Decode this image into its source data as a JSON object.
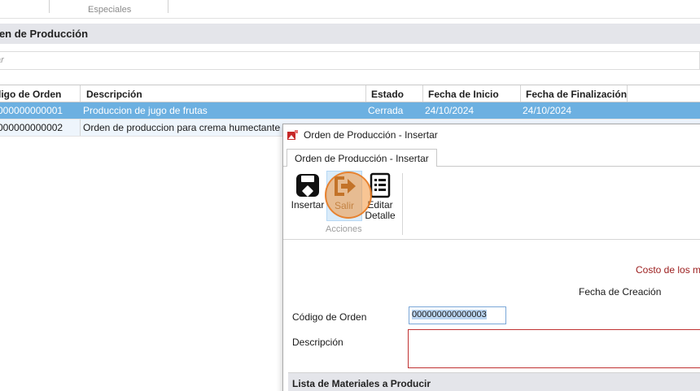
{
  "ribbon_top": {
    "group_label": "Especiales"
  },
  "page": {
    "title": "den de Producción",
    "search_placeholder": "scar"
  },
  "grid": {
    "columns": [
      "digo de Orden",
      "Descripción",
      "Estado",
      "Fecha de Inicio",
      "Fecha de Finalización"
    ],
    "rows": [
      {
        "codigo": "000000000001",
        "descripcion": "Produccion de jugo de frutas",
        "estado": "Cerrada",
        "inicio": "24/10/2024",
        "fin": "24/10/2024"
      },
      {
        "codigo": "000000000002",
        "descripcion": "Orden de produccion para crema humectante",
        "estado": "",
        "inicio": "",
        "fin": ""
      }
    ],
    "selected_row": 0
  },
  "dialog": {
    "title": "Orden de Producción - Insertar",
    "tab_label": "Orden de Producción - Insertar",
    "buttons": {
      "insertar": "Insertar",
      "salir": "Salir",
      "editar_line1": "Editar",
      "editar_line2": "Detalle"
    },
    "group_label": "Acciones",
    "costo_label": "Costo de los m",
    "fecha_creacion_label": "Fecha de Creación",
    "codigo_label": "Código de Orden",
    "codigo_value": "000000000000003",
    "descripcion_label": "Descripción",
    "lista_header": "Lista de Materiales a Producir"
  },
  "colors": {
    "selected_row": "#6cb0e1",
    "alt_row": "#eef5fc",
    "header_band": "#e4e5ea",
    "required_border": "#c03232",
    "cursor_highlight": "#f3963c"
  }
}
